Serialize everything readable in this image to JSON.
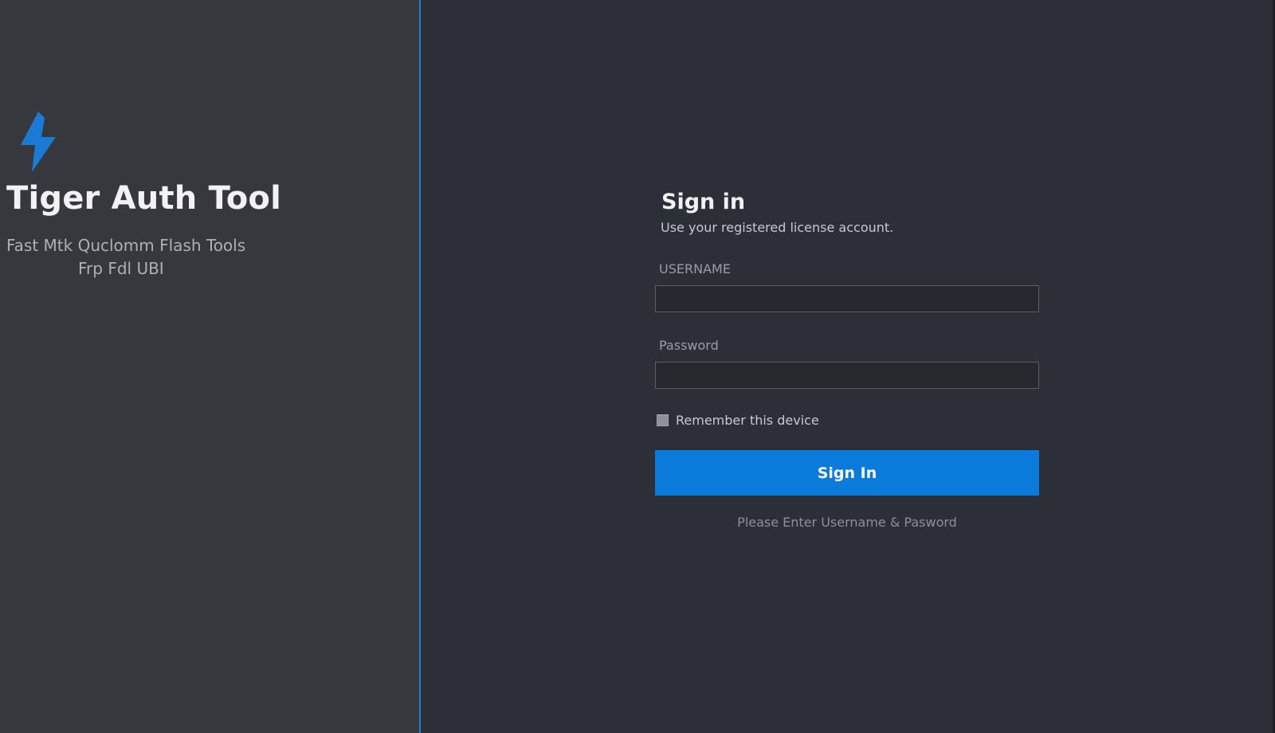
{
  "brand": {
    "title": "Tiger Auth Tool",
    "tagline_line1": "Fast Mtk  Quclomm Flash Tools",
    "tagline_line2": "Frp  Fdl  UBI",
    "icon": "lightning-bolt-icon",
    "accent_color": "#0a7bda"
  },
  "signin": {
    "title": "Sign in",
    "subtitle": "Use your registered license account.",
    "username_label": "USERNAME",
    "username_value": "",
    "password_label": "Password",
    "password_value": "",
    "remember_label": "Remember this device",
    "remember_checked": false,
    "button_label": "Sign In",
    "status_message": "Please Enter Username & Pasword"
  },
  "colors": {
    "left_panel": "#37383e",
    "right_panel": "#2c2f37",
    "divider": "#1f7fd6",
    "button": "#0a7bda"
  }
}
